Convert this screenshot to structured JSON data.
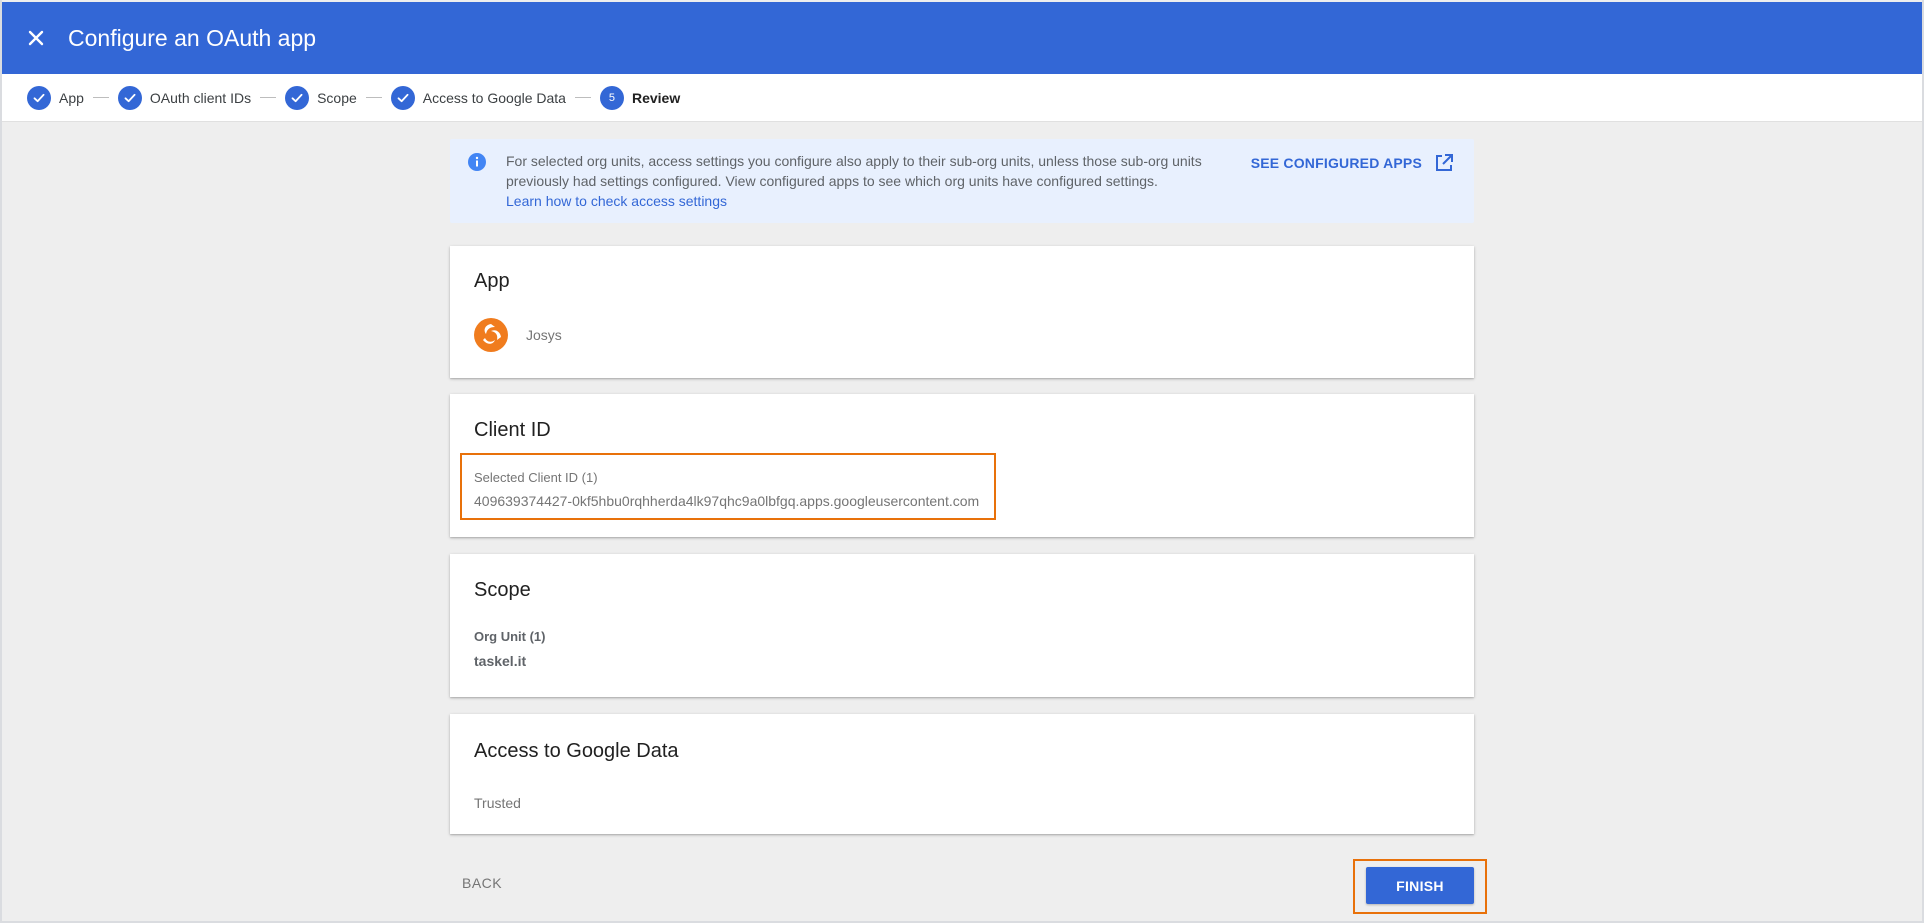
{
  "header": {
    "title": "Configure an OAuth app"
  },
  "stepper": {
    "steps": [
      {
        "label": "App",
        "state": "done"
      },
      {
        "label": "OAuth client IDs",
        "state": "done"
      },
      {
        "label": "Scope",
        "state": "done"
      },
      {
        "label": "Access to Google Data",
        "state": "done"
      },
      {
        "label": "Review",
        "state": "active",
        "number": "5"
      }
    ]
  },
  "banner": {
    "text": "For selected org units, access settings you configure also apply to their sub-org units, unless those sub-org units previously had settings configured. View configured apps to see which org units have configured settings.",
    "link": "Learn how to check access settings",
    "action": "SEE CONFIGURED APPS"
  },
  "app_card": {
    "title": "App",
    "app_name": "Josys",
    "logo_icon": "josys-logo-icon"
  },
  "client_card": {
    "title": "Client ID",
    "label": "Selected Client ID (1)",
    "value": "409639374427-0kf5hbu0rqhherda4lk97qhc9a0lbfgq.apps.googleusercontent.com"
  },
  "scope_card": {
    "title": "Scope",
    "label": "Org Unit (1)",
    "value": "taskel.it"
  },
  "access_card": {
    "title": "Access to Google Data",
    "value": "Trusted"
  },
  "footer": {
    "back": "BACK",
    "finish": "FINISH"
  },
  "colors": {
    "primary": "#3367d6",
    "highlight": "#e8710a",
    "banner_bg": "#e8f0fe",
    "page_bg": "#eeeeee",
    "logo": "#f07c1e"
  }
}
